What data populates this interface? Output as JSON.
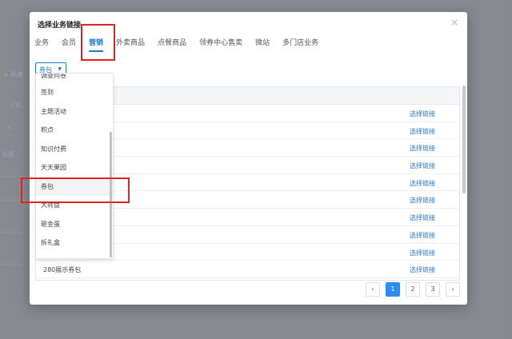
{
  "background": {
    "fragment_add": "+ 新建",
    "fragment_slash": "/ V",
    "fragment_all": "全部",
    "fragment_dot": "•"
  },
  "modal": {
    "title": "选择业务链接",
    "close_icon": "close-icon"
  },
  "tabs": [
    {
      "label": "业务"
    },
    {
      "label": "会员"
    },
    {
      "label": "营销",
      "active": true
    },
    {
      "label": "外卖商品"
    },
    {
      "label": "点餐商品"
    },
    {
      "label": "领券中心售卖"
    },
    {
      "label": "微站"
    },
    {
      "label": "多门店业务"
    }
  ],
  "filter": {
    "selected": "券包",
    "options": [
      "调查问卷",
      "签到",
      "主题活动",
      "积点",
      "知识付费",
      "天天果园",
      "券包",
      "大转盘",
      "砸金蛋",
      "拆礼盒"
    ]
  },
  "table": {
    "rows": [
      {
        "name": "",
        "action": "选择链接"
      },
      {
        "name": "",
        "action": "选择链接"
      },
      {
        "name": "",
        "action": "选择链接"
      },
      {
        "name": "",
        "action": "选择链接"
      },
      {
        "name": "",
        "action": "选择链接"
      },
      {
        "name": "",
        "action": "选择链接"
      },
      {
        "name": "",
        "action": "选择链接"
      },
      {
        "name": "",
        "action": "选择链接"
      },
      {
        "name": "",
        "action": "选择链接"
      },
      {
        "name": "280展示券包",
        "action": "选择链接"
      }
    ]
  },
  "pagination": {
    "prev_icon": "chevron-left-icon",
    "pages": [
      "1",
      "2",
      "3"
    ],
    "current": "1",
    "next_icon": "chevron-right-icon"
  },
  "colors": {
    "accent": "#1f7bd8",
    "highlight_box": "#e02323"
  }
}
